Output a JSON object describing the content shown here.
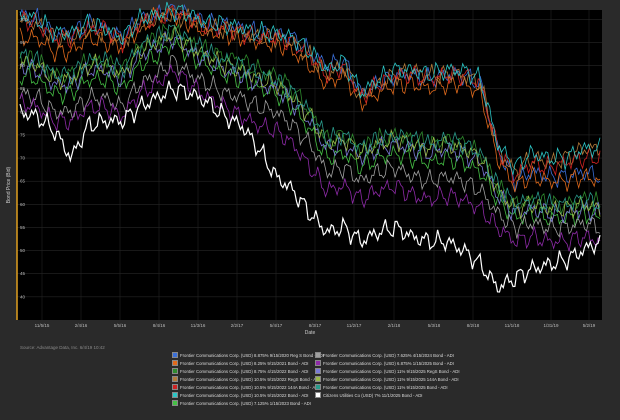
{
  "source_note": "Source: Advantage Data, Inc. 6/4/19 10:42",
  "chart_data": {
    "type": "line",
    "xlabel": "Date",
    "ylabel": "Bond Price (Bid)",
    "ylim": [
      35,
      102
    ],
    "y_ticks": [
      40,
      45,
      50,
      55,
      60,
      65,
      70,
      75,
      80,
      85,
      90,
      95,
      100
    ],
    "x_ticks": [
      "11/5/15",
      "2/4/16",
      "5/5/16",
      "8/4/16",
      "11/3/16",
      "2/2/17",
      "5/4/17",
      "8/3/17",
      "11/2/17",
      "2/1/18",
      "5/3/18",
      "8/2/18",
      "11/1/18",
      "1/31/19",
      "5/2/19"
    ],
    "grid": true,
    "legend_position": "bottom",
    "series": [
      {
        "name": "Frontier Communications Corp. (USD) 8.875% 9/15/2020 Reg S Bond - ADI",
        "color": "#3a6fd8",
        "values": [
          101,
          100,
          97,
          97,
          99,
          98,
          96,
          100,
          101,
          102,
          101,
          99,
          99,
          98,
          97,
          97,
          96,
          93,
          90,
          91,
          84,
          86,
          88,
          88,
          87,
          88,
          88,
          86,
          72,
          65,
          67,
          66,
          66,
          67,
          66
        ]
      },
      {
        "name": "Frontier Communications Corp. (USD) 8.25% 9/15/2021 Bond - ADI",
        "color": "#e06a1c",
        "values": [
          96,
          96,
          93,
          93,
          96,
          95,
          94,
          98,
          101,
          101,
          99,
          97,
          97,
          96,
          95,
          95,
          93,
          90,
          86,
          88,
          82,
          84,
          86,
          86,
          85,
          86,
          86,
          84,
          70,
          64,
          66,
          65,
          65,
          66,
          65
        ]
      },
      {
        "name": "Frontier Communications Corp. (USD) 8.75% 4/15/2022 Bond - ADI",
        "color": "#2e8a2e",
        "values": [
          92,
          91,
          88,
          88,
          91,
          91,
          89,
          94,
          96,
          98,
          95,
          93,
          92,
          91,
          89,
          88,
          85,
          80,
          74,
          75,
          72,
          74,
          75,
          74,
          73,
          74,
          73,
          71,
          64,
          60,
          61,
          60,
          60,
          61,
          60
        ]
      },
      {
        "name": "Frontier Communications Corp. (USD) 10.5% 9/15/2022 RegS Bond - ADI",
        "color": "#b07a3a",
        "values": [
          100,
          99,
          96,
          96,
          98,
          97,
          95,
          99,
          100,
          101,
          100,
          98,
          98,
          97,
          96,
          96,
          95,
          92,
          88,
          90,
          83,
          86,
          88,
          89,
          88,
          88,
          88,
          86,
          72,
          67,
          70,
          69,
          70,
          72,
          72
        ]
      },
      {
        "name": "Frontier Communications Corp. (USD) 10.5% 9/15/2022 144A Bond - ADI",
        "color": "#cc2222",
        "values": [
          100,
          99,
          96,
          96,
          98,
          98,
          95,
          99,
          100,
          102,
          100,
          98,
          98,
          97,
          96,
          96,
          95,
          92,
          88,
          90,
          83,
          86,
          88,
          88,
          87,
          88,
          88,
          86,
          72,
          66,
          69,
          68,
          69,
          70,
          70
        ]
      },
      {
        "name": "Frontier Communications Corp. (USD) 10.5% 9/15/2022 Bond - ADI",
        "color": "#2cc6c6",
        "values": [
          101,
          100,
          97,
          97,
          99,
          98,
          96,
          100,
          101,
          102,
          101,
          99,
          99,
          98,
          97,
          97,
          96,
          93,
          89,
          91,
          84,
          87,
          89,
          89,
          88,
          89,
          89,
          87,
          73,
          68,
          71,
          70,
          70,
          72,
          72
        ]
      },
      {
        "name": "Frontier Communications Corp. (USD) 7.125% 1/15/2023 Bond - ADI",
        "color": "#45c045",
        "values": [
          88,
          87,
          84,
          84,
          87,
          87,
          85,
          90,
          92,
          95,
          92,
          90,
          88,
          87,
          85,
          84,
          81,
          76,
          70,
          71,
          68,
          70,
          71,
          70,
          69,
          70,
          69,
          67,
          61,
          57,
          58,
          57,
          57,
          58,
          57
        ]
      },
      {
        "name": "Frontier Communications Corp. (USD) 7.625% 4/15/2024 Bond - ADI",
        "color": "#a0a0a0",
        "values": [
          84,
          83,
          80,
          80,
          83,
          83,
          81,
          86,
          88,
          91,
          88,
          86,
          84,
          83,
          81,
          80,
          77,
          73,
          67,
          68,
          65,
          67,
          68,
          66,
          65,
          66,
          65,
          63,
          58,
          55,
          56,
          55,
          55,
          56,
          55
        ]
      },
      {
        "name": "Frontier Communications Corp. (USD) 6.875% 1/15/2025 Bond - ADI",
        "color": "#8e2aa8",
        "values": [
          82,
          81,
          78,
          78,
          81,
          81,
          79,
          84,
          86,
          89,
          86,
          83,
          81,
          79,
          77,
          76,
          73,
          68,
          63,
          64,
          61,
          63,
          64,
          62,
          61,
          62,
          61,
          59,
          55,
          52,
          53,
          52,
          52,
          53,
          52
        ]
      },
      {
        "name": "Frontier Communications Corp. (USD) 11% 9/15/2025 RegS Bond - ADI",
        "color": "#7a7ad8",
        "values": [
          90,
          89,
          86,
          86,
          89,
          89,
          87,
          92,
          94,
          96,
          93,
          91,
          89,
          88,
          86,
          85,
          82,
          78,
          72,
          73,
          70,
          72,
          73,
          72,
          71,
          72,
          71,
          69,
          62,
          58,
          59,
          58,
          58,
          59,
          58
        ]
      },
      {
        "name": "Frontier Communications Corp. (USD) 11% 9/15/2025 144A Bond - ADI",
        "color": "#9ab84a",
        "values": [
          91,
          90,
          87,
          87,
          90,
          90,
          88,
          93,
          95,
          97,
          94,
          92,
          90,
          89,
          87,
          86,
          83,
          79,
          73,
          74,
          71,
          73,
          74,
          73,
          72,
          73,
          72,
          70,
          63,
          59,
          60,
          59,
          59,
          60,
          59
        ]
      },
      {
        "name": "Frontier Communications Corp. (USD) 11% 9/15/2025 Bond - ADI",
        "color": "#2a9a8a",
        "values": [
          92,
          91,
          88,
          88,
          91,
          91,
          89,
          94,
          96,
          98,
          95,
          93,
          91,
          90,
          88,
          87,
          84,
          80,
          74,
          75,
          72,
          74,
          75,
          74,
          73,
          74,
          73,
          71,
          64,
          60,
          61,
          60,
          60,
          61,
          60
        ]
      },
      {
        "name": "Citizens Utilities Co (USD) 7% 11/1/2025 Bond - ADI",
        "color": "#ffffff",
        "values": [
          80,
          79,
          76,
          70,
          77,
          78,
          78,
          81,
          83,
          85,
          84,
          82,
          79,
          77,
          72,
          66,
          63,
          58,
          54,
          55,
          52,
          54,
          55,
          53,
          52,
          52,
          50,
          47,
          42,
          44,
          46,
          47,
          48,
          50,
          52
        ]
      }
    ]
  }
}
